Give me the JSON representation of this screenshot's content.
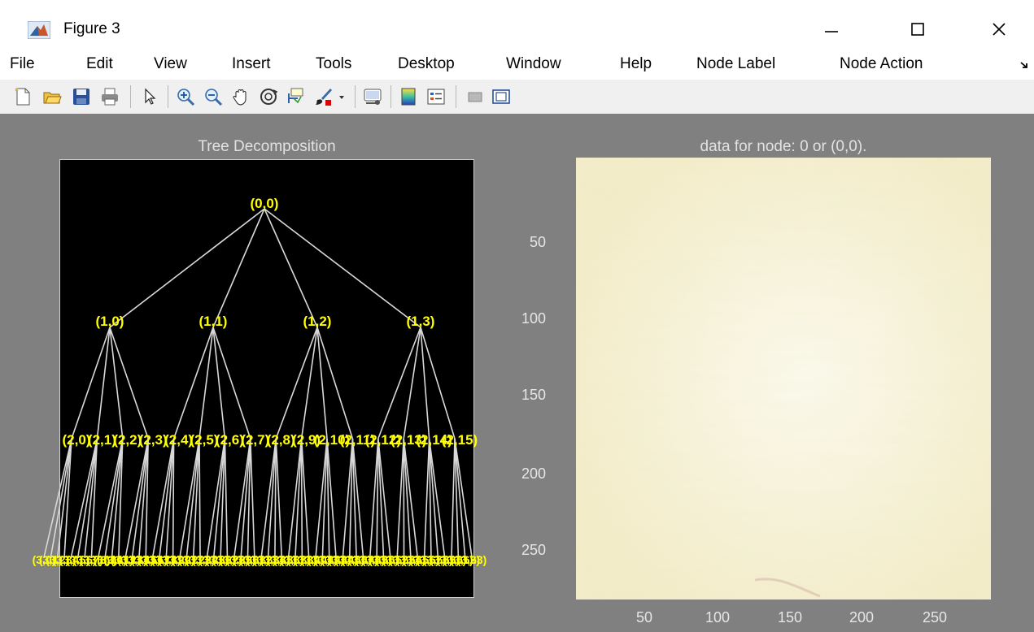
{
  "window": {
    "title": "Figure 3",
    "icon": "matlab-logo-icon",
    "controls": [
      "minimize-icon",
      "maximize-icon",
      "close-icon"
    ]
  },
  "menu": {
    "items": [
      "File",
      "Edit",
      "View",
      "Insert",
      "Tools",
      "Desktop",
      "Window",
      "Help",
      "Node Label",
      "Node Action"
    ],
    "overflow_icon": "chevron-right-icon"
  },
  "toolbar": {
    "buttons": [
      "new-figure-icon",
      "open-file-icon",
      "save-icon",
      "print-icon",
      "pointer-icon",
      "zoom-in-icon",
      "zoom-out-icon",
      "pan-hand-icon",
      "rotate-3d-icon",
      "data-cursor-icon",
      "brush-icon",
      "dropdown-arrow-icon",
      "link-plot-icon",
      "colorbar-icon",
      "legend-icon",
      "hide-plot-tools-icon",
      "show-plot-tools-icon"
    ]
  },
  "tree_panel": {
    "title": "Tree Decomposition",
    "root": "(0,0)",
    "level1": [
      "(1,0)",
      "(1,1)",
      "(1,2)",
      "(1,3)"
    ],
    "level2": [
      "(2,0)",
      "(2,1)",
      "(2,2)",
      "(2,3)",
      "(2,4)",
      "(2,5)",
      "(2,6)",
      "(2,7)",
      "(2,8)",
      "(2,9)",
      "(2,10)",
      "(2,11)",
      "(2,12)",
      "(2,13)",
      "(2,14)",
      "(2,15)"
    ],
    "level3_prefix": "(3,",
    "level3_count": 64,
    "colors": {
      "background": "#000000",
      "edge": "#d9d9d9",
      "label": "#ffff00"
    }
  },
  "image_panel": {
    "title": "data for node: 0 or (0,0).",
    "y_ticks": [
      "50",
      "100",
      "150",
      "200",
      "250"
    ],
    "x_ticks": [
      "50",
      "100",
      "150",
      "200",
      "250"
    ],
    "colors": {
      "base": "#f6f1d6",
      "highlight": "#fbfaee"
    }
  }
}
